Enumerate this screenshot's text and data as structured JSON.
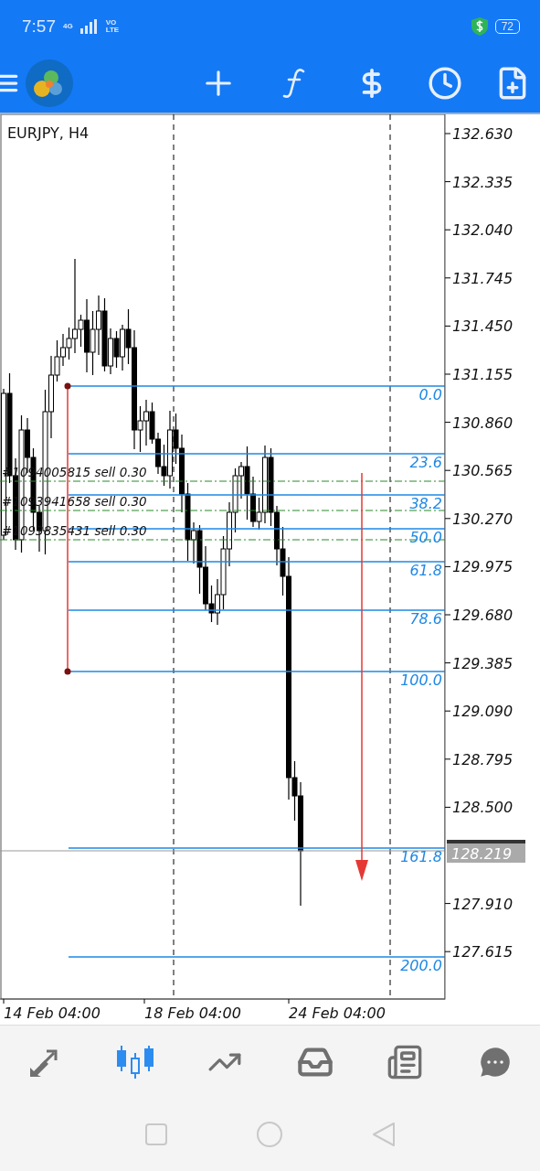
{
  "status_bar": {
    "time": "7:57",
    "network": "4G",
    "volte_top": "VO",
    "volte_bottom": "LTE",
    "battery": "72"
  },
  "chart": {
    "symbol": "EURJPY, H4",
    "price_ticks": [
      "132.630",
      "132.335",
      "132.040",
      "131.745",
      "131.450",
      "131.155",
      "130.860",
      "130.565",
      "130.270",
      "129.975",
      "129.680",
      "129.385",
      "129.090",
      "128.795",
      "128.500",
      "127.910",
      "127.615"
    ],
    "current_price": "128.219",
    "fib_levels": [
      {
        "label": "0.0"
      },
      {
        "label": "23.6"
      },
      {
        "label": "38.2"
      },
      {
        "label": "50.0"
      },
      {
        "label": "61.8"
      },
      {
        "label": "78.6"
      },
      {
        "label": "100.0"
      },
      {
        "label": "161.8"
      },
      {
        "label": "200.0"
      }
    ],
    "orders": [
      {
        "label": "#1094005815 sell 0.30"
      },
      {
        "label": "#1093941658 sell 0.30"
      },
      {
        "label": "#1093835431 sell 0.30"
      }
    ],
    "time_labels": [
      "14 Feb 04:00",
      "18 Feb 04:00",
      "24 Feb 04:00"
    ]
  },
  "bottom_nav": {
    "items": [
      {
        "kind": "quotes",
        "selected": false
      },
      {
        "kind": "chart",
        "selected": true
      },
      {
        "kind": "trade",
        "selected": false
      },
      {
        "kind": "history",
        "selected": false
      },
      {
        "kind": "news",
        "selected": false
      },
      {
        "kind": "chat",
        "selected": false
      }
    ]
  }
}
